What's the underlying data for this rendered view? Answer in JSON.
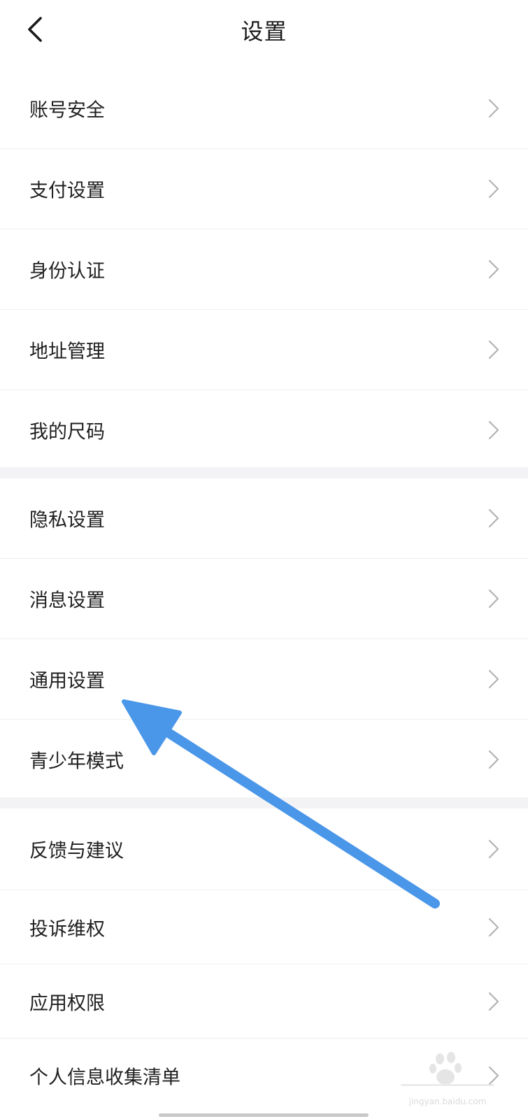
{
  "header": {
    "title": "设置",
    "back_icon": "chevron-left-icon"
  },
  "groups": [
    {
      "items": [
        {
          "label": "账号安全"
        },
        {
          "label": "支付设置"
        },
        {
          "label": "身份认证"
        },
        {
          "label": "地址管理"
        },
        {
          "label": "我的尺码"
        }
      ]
    },
    {
      "items": [
        {
          "label": "隐私设置"
        },
        {
          "label": "消息设置"
        },
        {
          "label": "通用设置"
        },
        {
          "label": "青少年模式"
        }
      ]
    },
    {
      "items": [
        {
          "label": "反馈与建议"
        },
        {
          "label": "投诉维权"
        },
        {
          "label": "应用权限"
        },
        {
          "label": "个人信息收集清单"
        }
      ]
    }
  ],
  "row_chevron_icon": "chevron-right-icon",
  "annotation": {
    "icon": "pointer-arrow-icon",
    "color": "#4a96e8"
  },
  "watermark": {
    "text": "jingyan.baidu.com"
  },
  "colors": {
    "background": "#ffffff",
    "separator": "#f3f3f5",
    "divider": "#efefef",
    "text": "#1f1f1f",
    "chevron": "#b3b3b3"
  }
}
